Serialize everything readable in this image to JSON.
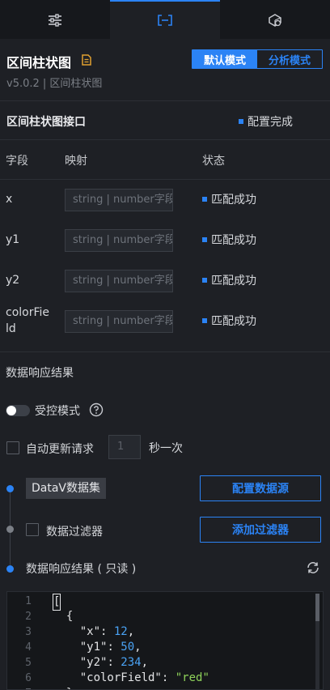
{
  "tabs": [
    {
      "icon": "sliders-icon",
      "active": false
    },
    {
      "icon": "bracket-box-icon",
      "active": true
    },
    {
      "icon": "cube-icon",
      "active": false
    }
  ],
  "header": {
    "title": "区间柱状图",
    "version": "v5.0.2 | 区间柱状图",
    "modes": [
      "默认模式",
      "分析模式"
    ]
  },
  "interface": {
    "title": "区间柱状图接口",
    "status": "配置完成",
    "columns": [
      "字段",
      "映射",
      "状态"
    ],
    "rows": [
      {
        "field": "x",
        "placeholder": "string | number字段",
        "status": "匹配成功"
      },
      {
        "field": "y1",
        "placeholder": "string | number字段",
        "status": "匹配成功"
      },
      {
        "field": "y2",
        "placeholder": "string | number字段",
        "status": "匹配成功"
      },
      {
        "field_line1": "colorFie",
        "field_line2": "ld",
        "placeholder": "string | number字段",
        "status": "匹配成功"
      }
    ]
  },
  "data_response": {
    "title": "数据响应结果",
    "controlled_label": "受控模式",
    "auto_update_label": "自动更新请求",
    "interval_value": "1",
    "interval_unit": "秒一次"
  },
  "pipeline": {
    "source_tag": "DataV数据集",
    "config_source_btn": "配置数据源",
    "filter_label": "数据过滤器",
    "add_filter_btn": "添加过滤器",
    "result_label": "数据响应结果 ( 只读 )"
  },
  "code": {
    "line_numbers": [
      "1",
      "2",
      "3",
      "4",
      "5",
      "6",
      "7"
    ],
    "l1": "[",
    "l2": "  {",
    "l3_key": "\"x\"",
    "l3_val": "12",
    "l4_key": "\"y1\"",
    "l4_val": "50",
    "l5_key": "\"y2\"",
    "l5_val": "234",
    "l6_key": "\"colorField\"",
    "l6_val": "\"red\"",
    "l7": "  },"
  },
  "colors": {
    "accent": "#2b83f5",
    "bg": "#1e2025",
    "number": "#4aa3f5",
    "string": "#8fd35a"
  }
}
